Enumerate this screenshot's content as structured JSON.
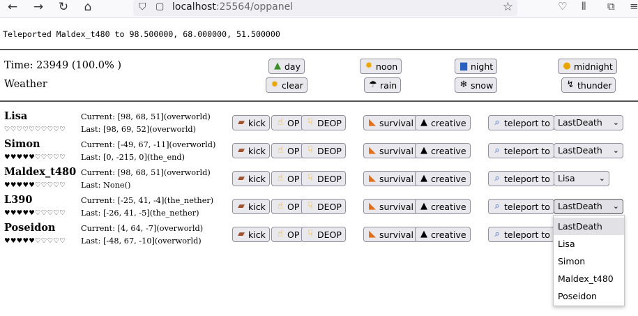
{
  "browser": {
    "url_host": "localhost",
    "url_port": ":25564",
    "url_path": "/oppanel"
  },
  "message": "Teleported Maldex_t480 to 98.500000, 68.000000, 51.500000",
  "world": {
    "time_label": "Time: 23949 (100.0% )",
    "weather_label": "Weather",
    "time_buttons": [
      {
        "label": "day",
        "icon": "grass-block-icon"
      },
      {
        "label": "noon",
        "icon": "sun-icon"
      },
      {
        "label": "night",
        "icon": "night-city-icon"
      },
      {
        "label": "midnight",
        "icon": "moon-icon"
      }
    ],
    "weather_buttons": [
      {
        "label": "clear",
        "icon": "sun-icon"
      },
      {
        "label": "rain",
        "icon": "umbrella-icon"
      },
      {
        "label": "snow",
        "icon": "snowflake-icon"
      },
      {
        "label": "thunder",
        "icon": "lightning-icon"
      }
    ]
  },
  "actions": {
    "kick": "kick",
    "op": "OP",
    "deop": "DEOP",
    "survival": "survival",
    "creative": "creative",
    "teleport": "teleport to"
  },
  "players": [
    {
      "name": "Lisa",
      "hearts": "♡♡♡♡♡♡♡♡♡♡",
      "current": "Current: [98, 68, 51](overworld)",
      "last": "Last: [98, 69, 52](overworld)",
      "target": "LastDeath"
    },
    {
      "name": "Simon",
      "hearts": "♥♥♥♥♥♡♡♡♡♡",
      "current": "Current: [-49, 67, -11](overworld)",
      "last": "Last: [0, -215, 0](the_end)",
      "target": "LastDeath"
    },
    {
      "name": "Maldex_t480",
      "hearts": "♥♥♥♥♥♡♡♡♡♡",
      "current": "Current: [98, 68, 51](overworld)",
      "last": "Last: None()",
      "target": "Lisa"
    },
    {
      "name": "L390",
      "hearts": "♥♥♥♥♥♡♡♡♡♡",
      "current": "Current: [-25, 41, -4](the_nether)",
      "last": "Last: [-26, 41, -5](the_nether)",
      "target": "LastDeath"
    },
    {
      "name": "Poseidon",
      "hearts": "♥♥♥♥♥♡♡♡♡♡",
      "current": "Current: [4, 64, -7](overworld)",
      "last": "Last: [-48, 67, -10](overworld)",
      "target": "LastDeath"
    }
  ],
  "dropdown_options": [
    "LastDeath",
    "Lisa",
    "Simon",
    "Maldex_t480",
    "Poseidon"
  ]
}
